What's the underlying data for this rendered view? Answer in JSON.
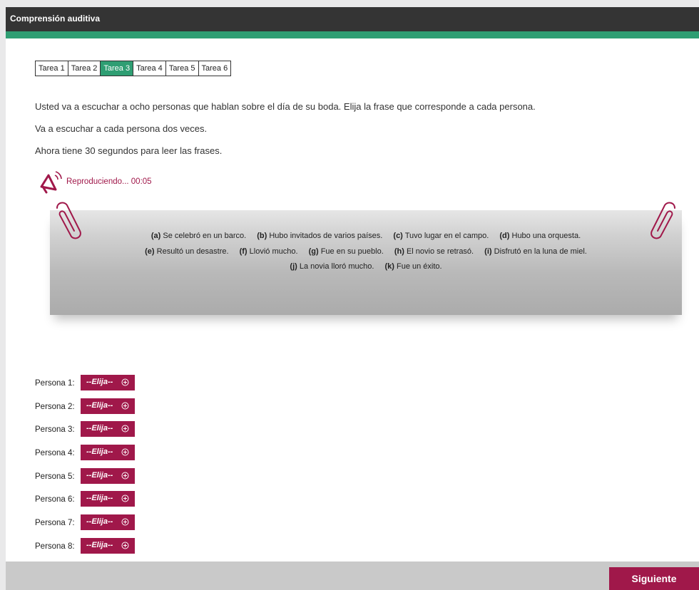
{
  "header": {
    "title": "Comprensión auditiva"
  },
  "colors": {
    "header_bg": "#343434",
    "accent_green": "#2f9e73",
    "accent_maroon": "#a0184a"
  },
  "tabs": [
    {
      "label": "Tarea 1",
      "active": false
    },
    {
      "label": "Tarea 2",
      "active": false
    },
    {
      "label": "Tarea 3",
      "active": true
    },
    {
      "label": "Tarea 4",
      "active": false
    },
    {
      "label": "Tarea 5",
      "active": false
    },
    {
      "label": "Tarea 6",
      "active": false
    }
  ],
  "instructions": [
    "Usted va a escuchar a ocho personas que hablan sobre el día de su boda. Elija la frase que corresponde a cada persona.",
    "Va a escuchar a cada persona dos veces.",
    "Ahora tiene 30 segundos para leer las frases."
  ],
  "player": {
    "icon": "megaphone-icon",
    "status": "Reproduciendo... 00:05"
  },
  "options": [
    {
      "letter": "(a)",
      "text": "Se celebró en un barco."
    },
    {
      "letter": "(b)",
      "text": "Hubo invitados de varios países."
    },
    {
      "letter": "(c)",
      "text": "Tuvo lugar en el campo."
    },
    {
      "letter": "(d)",
      "text": "Hubo una orquesta."
    },
    {
      "letter": "(e)",
      "text": "Resultó un desastre."
    },
    {
      "letter": "(f)",
      "text": "Llovió mucho."
    },
    {
      "letter": "(g)",
      "text": "Fue en su pueblo."
    },
    {
      "letter": "(h)",
      "text": "El novio se retrasó."
    },
    {
      "letter": "(i)",
      "text": "Disfrutó en la luna de miel."
    },
    {
      "letter": "(j)",
      "text": "La novia lloró mucho."
    },
    {
      "letter": "(k)",
      "text": "Fue un éxito."
    }
  ],
  "answers": [
    {
      "label": "Persona 1:",
      "value": "--Elija--"
    },
    {
      "label": "Persona 2:",
      "value": "--Elija--"
    },
    {
      "label": "Persona 3:",
      "value": "--Elija--"
    },
    {
      "label": "Persona 4:",
      "value": "--Elija--"
    },
    {
      "label": "Persona 5:",
      "value": "--Elija--"
    },
    {
      "label": "Persona 6:",
      "value": "--Elija--"
    },
    {
      "label": "Persona 7:",
      "value": "--Elija--"
    },
    {
      "label": "Persona 8:",
      "value": "--Elija--"
    }
  ],
  "footer": {
    "next_label": "Siguiente"
  }
}
